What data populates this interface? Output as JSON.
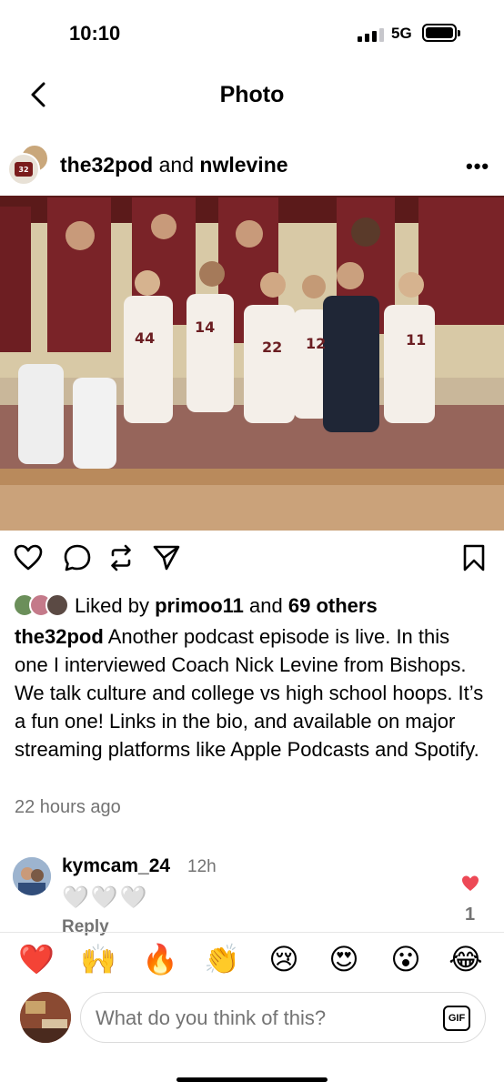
{
  "status": {
    "time": "10:10",
    "network": "5G",
    "signal_bars_filled": 3,
    "signal_bars_total": 4
  },
  "nav": {
    "title": "Photo",
    "back_icon": "chevron-left-icon"
  },
  "post": {
    "author1": "the32pod",
    "and": "and",
    "author2": "nwlevine",
    "more_label": "•••",
    "avatar_text": "32 PODCAST",
    "photo_alt": "Basketball team on bench"
  },
  "actions": {
    "like_icon": "heart-outline-icon",
    "comment_icon": "comment-bubble-icon",
    "repost_icon": "repost-icon",
    "share_icon": "send-icon",
    "save_icon": "bookmark-icon"
  },
  "likes": {
    "prefix": "Liked by",
    "user": "primoo11",
    "middle": "and",
    "others": "69 others"
  },
  "caption": {
    "username": "the32pod",
    "text": "Another podcast episode is live. In this one I interviewed Coach Nick Levine from Bishops. We talk culture and college vs high school hoops. It’s a fun one! Links in the bio, and available on major streaming platforms like Apple Podcasts and Spotify."
  },
  "timeago": "22 hours ago",
  "comment": {
    "username": "kymcam_24",
    "time": "12h",
    "hearts": "🤍🤍🤍",
    "reply_label": "Reply",
    "like_count": "1"
  },
  "emoji_bar": [
    "❤️",
    "🙌",
    "🔥",
    "👏",
    "😢",
    "😍",
    "😮",
    "😂"
  ],
  "composer": {
    "placeholder": "What do you think of this?",
    "gif_label": "GIF"
  },
  "colors": {
    "accent_red": "#ed4956",
    "muted": "#737373"
  }
}
